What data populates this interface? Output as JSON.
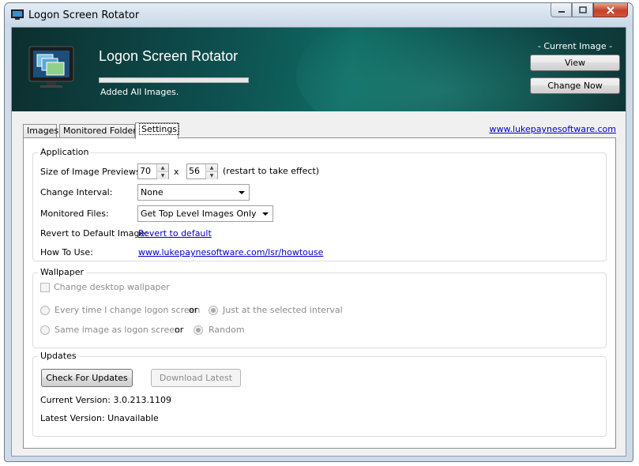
{
  "window": {
    "title": "Logon Screen Rotator"
  },
  "header": {
    "app_title": "Logon Screen Rotator",
    "status": "Added All Images.",
    "progress": 1.0,
    "current_image_label": "- Current Image -",
    "view_label": "View",
    "change_now_label": "Change Now"
  },
  "tabs": [
    {
      "label": "Images"
    },
    {
      "label": "Monitored Folders"
    },
    {
      "label": "Settings"
    }
  ],
  "website_link": "www.lukepaynesoftware.com",
  "application": {
    "title": "Application",
    "preview_size_label": "Size of Image Previews:",
    "preview_width": "70",
    "times": "x",
    "preview_height": "56",
    "restart_note": "(restart to take effect)",
    "change_interval_label": "Change Interval:",
    "change_interval_value": "None",
    "monitored_files_label": "Monitored Files:",
    "monitored_files_value": "Get Top Level Images Only",
    "revert_label": "Revert to Default Image:",
    "revert_link": "Revert to default",
    "how_to_label": "How To Use:",
    "how_to_link": "www.lukepaynesoftware.com/lsr/howtouse"
  },
  "wallpaper": {
    "title": "Wallpaper",
    "change_desktop": "Change desktop wallpaper",
    "every_time": "Every time I change logon screen",
    "or1": "or",
    "just_interval": "Just at the selected interval",
    "same_image": "Same image as logon screen",
    "or2": "or",
    "random": "Random"
  },
  "updates": {
    "title": "Updates",
    "check_label": "Check For Updates",
    "download_label": "Download Latest",
    "current_version": "Current Version: 3.0.213.1109",
    "latest_version": "Latest Version: Unavailable"
  }
}
